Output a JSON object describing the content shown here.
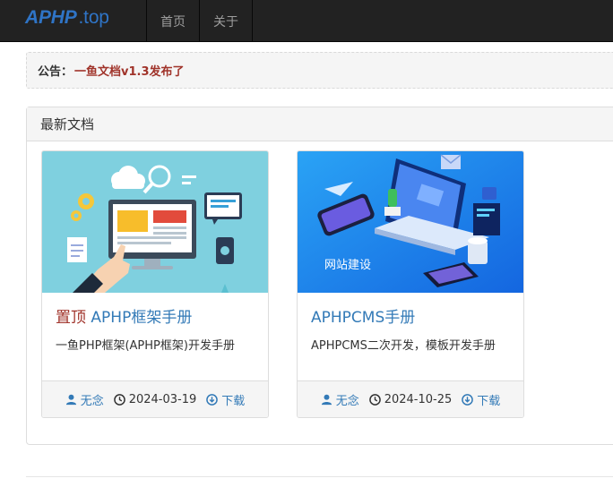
{
  "nav": {
    "brand_part1": "APHP",
    "brand_part2": ".top",
    "items": [
      {
        "label": "首页"
      },
      {
        "label": "关于"
      }
    ]
  },
  "notice": {
    "label": "公告：",
    "text": "一鱼文档v1.3发布了"
  },
  "panel": {
    "title": "最新文档"
  },
  "cards": [
    {
      "badge": "置顶",
      "title": "APHP框架手册",
      "description": "一鱼PHP框架(APHP框架)开发手册",
      "author": "无念",
      "date": "2024-03-19",
      "download": "下载"
    },
    {
      "badge": "",
      "title": "APHPCMS手册",
      "description": "APHPCMS二次开发，模板开发手册",
      "author": "无念",
      "date": "2024-10-25",
      "download": "下载",
      "image_text": "网站建设"
    }
  ],
  "colors": {
    "navbar": "#222222",
    "link": "#337ab7",
    "notice_text": "#a0332a",
    "thumb1_bg": "#7fd0df",
    "thumb2_bg": "#1e8ef0"
  }
}
